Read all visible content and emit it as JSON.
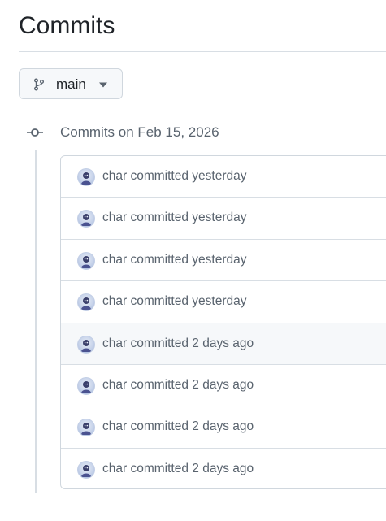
{
  "page": {
    "title": "Commits"
  },
  "branch": {
    "name": "main",
    "icon": "git-branch-icon",
    "caret_icon": "triangle-down-icon"
  },
  "group": {
    "heading": "Commits on Feb 15, 2026",
    "icon": "git-commit-icon"
  },
  "commits": [
    {
      "author": "char",
      "action": "committed",
      "when": "yesterday"
    },
    {
      "author": "char",
      "action": "committed",
      "when": "yesterday"
    },
    {
      "author": "char",
      "action": "committed",
      "when": "yesterday"
    },
    {
      "author": "char",
      "action": "committed",
      "when": "yesterday"
    },
    {
      "author": "char",
      "action": "committed",
      "when": "2 days ago"
    },
    {
      "author": "char",
      "action": "committed",
      "when": "2 days ago"
    },
    {
      "author": "char",
      "action": "committed",
      "when": "2 days ago"
    },
    {
      "author": "char",
      "action": "committed",
      "when": "2 days ago"
    }
  ],
  "colors": {
    "text": "#1f2328",
    "muted": "#59636e",
    "border": "#d0d7de",
    "hover_row": "#f6f8fa"
  }
}
